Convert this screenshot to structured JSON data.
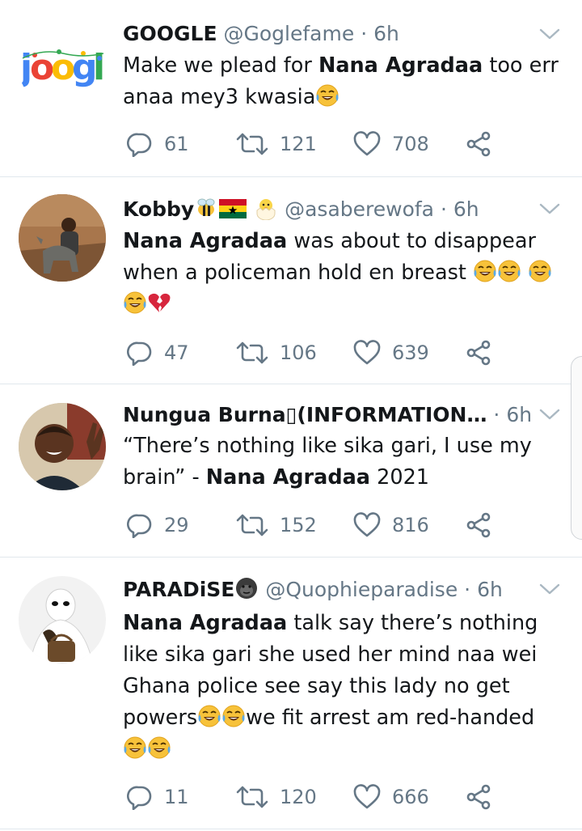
{
  "tweets": [
    {
      "name": "GOOGLE",
      "handle": "@Goglefame",
      "separator": "·",
      "time": "6h",
      "text_parts": [
        "Make we plead for ",
        "Nana Agradaa",
        " too err anaa mey3 kwasia"
      ],
      "emojis": [
        "face-with-tears-of-joy"
      ],
      "replies": "61",
      "retweets": "121",
      "likes": "708"
    },
    {
      "name": "Kobby",
      "name_emojis": [
        "honeybee",
        "flag-ghana",
        "hatching-chick"
      ],
      "handle": "@asaberewofa",
      "separator": "·",
      "time": "6h",
      "text_parts": [
        "Nana Agradaa",
        " was about to disappear when a policeman hold en breast "
      ],
      "emojis": [
        "face-with-tears-of-joy",
        "face-with-tears-of-joy",
        "face-with-tears-of-joy",
        "face-with-tears-of-joy",
        "broken-heart"
      ],
      "replies": "47",
      "retweets": "106",
      "likes": "639"
    },
    {
      "name": "Nungua Burna▯(INFORMATION…",
      "handle": "",
      "separator": "·",
      "time": "6h",
      "text_parts": [
        "“There’s nothing like sika gari, I use my brain” - ",
        "Nana Agradaa",
        " 2021"
      ],
      "emojis": [],
      "replies": "29",
      "retweets": "152",
      "likes": "816"
    },
    {
      "name": "PARADiSE",
      "name_emojis": [
        "gorilla"
      ],
      "handle": "@Quophieparadise",
      "separator": "·",
      "time": "6h",
      "text_parts": [
        "Nana Agradaa",
        " talk say there’s nothing like sika gari she used her mind naa wei Ghana police see say this lady no get powers",
        "we fit arrest am red-handed"
      ],
      "emojis": [
        "face-with-tears-of-joy",
        "face-with-tears-of-joy",
        "face-with-tears-of-joy",
        "face-with-tears-of-joy"
      ],
      "replies": "11",
      "retweets": "120",
      "likes": "666"
    }
  ],
  "icons": {
    "reply": "reply-icon",
    "retweet": "retweet-icon",
    "like": "like-icon",
    "share": "share-icon",
    "caret": "chevron-down-icon"
  },
  "colors": {
    "text": "#14171a",
    "secondary": "#657786",
    "divider": "#e1e8ed",
    "emoji_yellow": "#f7c23a",
    "emoji_tears": "#5aa9e6",
    "broken_heart": "#d7263d"
  }
}
